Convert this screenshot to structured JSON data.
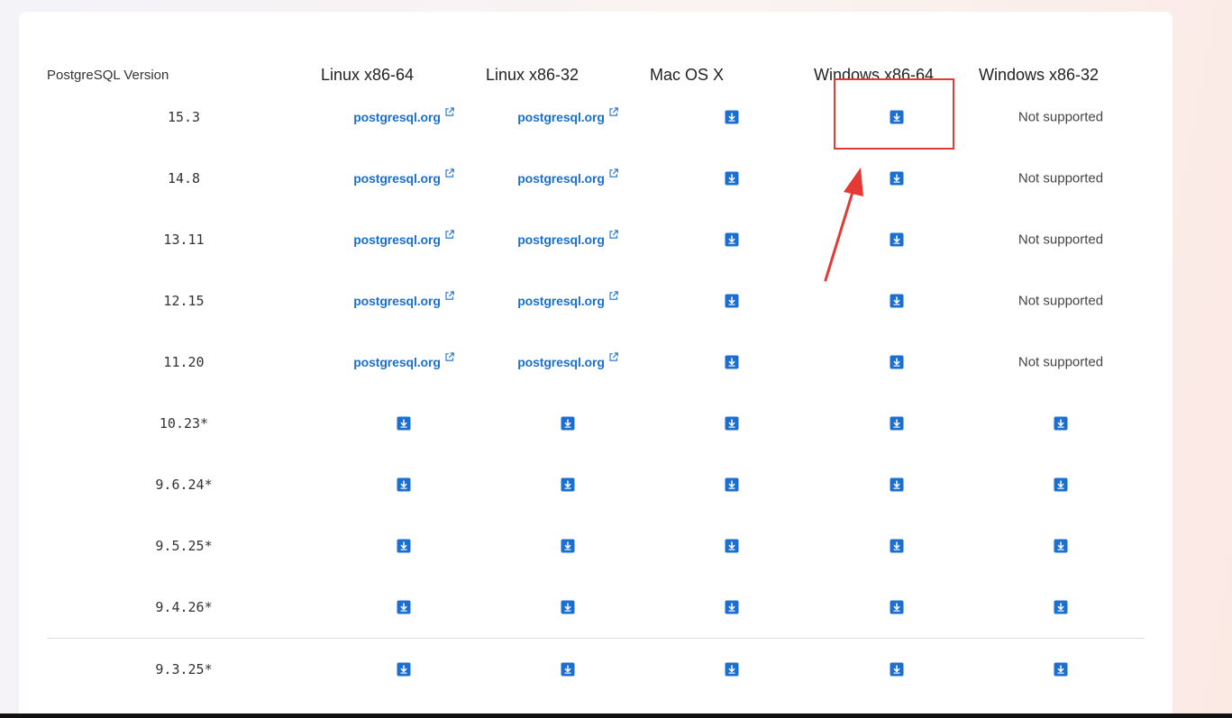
{
  "table": {
    "headers": {
      "version": "PostgreSQL Version",
      "linux64": "Linux x86-64",
      "linux32": "Linux x86-32",
      "mac": "Mac OS X",
      "win64": "Windows x86-64",
      "win32": "Windows x86-32"
    },
    "link_text": "postgresql.org",
    "not_supported_text": "Not supported",
    "rows": [
      {
        "version": "15.3",
        "linux64": "link",
        "linux32": "link",
        "mac": "download",
        "win64": "download",
        "win32": "not_supported"
      },
      {
        "version": "14.8",
        "linux64": "link",
        "linux32": "link",
        "mac": "download",
        "win64": "download",
        "win32": "not_supported"
      },
      {
        "version": "13.11",
        "linux64": "link",
        "linux32": "link",
        "mac": "download",
        "win64": "download",
        "win32": "not_supported"
      },
      {
        "version": "12.15",
        "linux64": "link",
        "linux32": "link",
        "mac": "download",
        "win64": "download",
        "win32": "not_supported"
      },
      {
        "version": "11.20",
        "linux64": "link",
        "linux32": "link",
        "mac": "download",
        "win64": "download",
        "win32": "not_supported"
      },
      {
        "version": "10.23*",
        "linux64": "download",
        "linux32": "download",
        "mac": "download",
        "win64": "download",
        "win32": "download"
      },
      {
        "version": "9.6.24*",
        "linux64": "download",
        "linux32": "download",
        "mac": "download",
        "win64": "download",
        "win32": "download"
      },
      {
        "version": "9.5.25*",
        "linux64": "download",
        "linux32": "download",
        "mac": "download",
        "win64": "download",
        "win32": "download"
      },
      {
        "version": "9.4.26*",
        "linux64": "download",
        "linux32": "download",
        "mac": "download",
        "win64": "download",
        "win32": "download"
      },
      {
        "version": "9.3.25*",
        "linux64": "download",
        "linux32": "download",
        "mac": "download",
        "win64": "download",
        "win32": "download"
      }
    ]
  },
  "annotation": {
    "highlight_color": "#e53935",
    "target": "Windows x86-64 download for 15.3"
  },
  "colors": {
    "link": "#1a6fd1",
    "download_icon": "#1a6fd1"
  },
  "icons": {
    "download": "download-icon",
    "external": "external-link-icon"
  }
}
